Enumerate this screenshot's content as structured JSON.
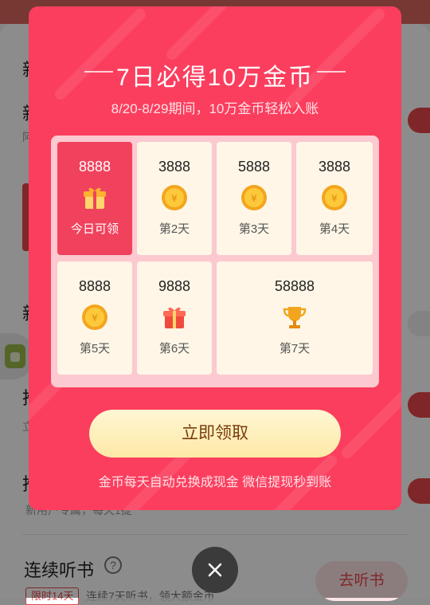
{
  "background": {
    "fragments": [
      "新",
      "新",
      "新",
      "推",
      "推"
    ],
    "sub_fragments": [
      "阿",
      "立",
      "新用户专属，每天1提"
    ],
    "bottom": {
      "title": "连续听书",
      "help_icon": "question-circle-icon",
      "listen_button": "去听书",
      "limit_tag": "限时14天",
      "limit_desc": "连续7天听书，领大额金币"
    }
  },
  "modal": {
    "title": "7日必得10万金币",
    "subtitle": "8/20-8/29期间，10万金币轻松入账",
    "days": [
      {
        "amount": "8888",
        "label": "今日可领",
        "icon": "gift-icon",
        "active": true
      },
      {
        "amount": "3888",
        "label": "第2天",
        "icon": "coin-icon",
        "active": false
      },
      {
        "amount": "5888",
        "label": "第3天",
        "icon": "coin-icon",
        "active": false
      },
      {
        "amount": "3888",
        "label": "第4天",
        "icon": "coin-icon",
        "active": false
      },
      {
        "amount": "8888",
        "label": "第5天",
        "icon": "coin-icon",
        "active": false
      },
      {
        "amount": "9888",
        "label": "第6天",
        "icon": "gift-icon",
        "active": false
      },
      {
        "amount": "58888",
        "label": "第7天",
        "icon": "trophy-icon",
        "active": false
      }
    ],
    "claim_button": "立即领取",
    "footer": "金币每天自动兑换成现金 微信提现秒到账",
    "close_icon": "close-icon"
  },
  "colors": {
    "modal_bg": "#fb3e5e",
    "cell_bg": "#fff6e7",
    "active_cell": "#f1425d",
    "button_gold": "#fde8a6",
    "accent_red": "#e8474a"
  }
}
